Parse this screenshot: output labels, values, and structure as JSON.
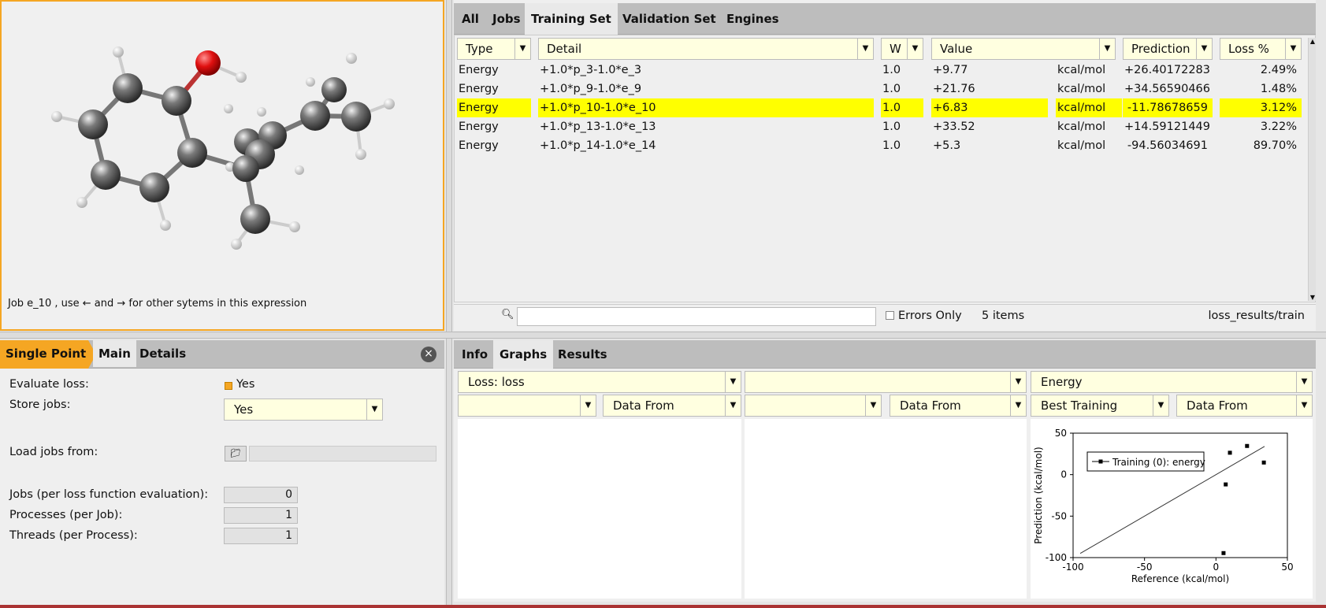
{
  "molecule_panel": {
    "caption": "Job e_10 , use ← and → for other sytems in this expression"
  },
  "top_tabs": [
    "All",
    "Jobs",
    "Training Set",
    "Validation Set",
    "Engines"
  ],
  "table": {
    "headers": {
      "type": "Type",
      "detail": "Detail",
      "w": "W",
      "value": "Value",
      "prediction": "Prediction",
      "loss": "Loss %"
    },
    "rows": [
      {
        "type": "Energy",
        "detail": "+1.0*p_3-1.0*e_3",
        "w": "1.0",
        "value": "+9.77",
        "unit": "kcal/mol",
        "prediction": "+26.40172283",
        "loss": "2.49%"
      },
      {
        "type": "Energy",
        "detail": "+1.0*p_9-1.0*e_9",
        "w": "1.0",
        "value": "+21.76",
        "unit": "kcal/mol",
        "prediction": "+34.56590466",
        "loss": "1.48%"
      },
      {
        "type": "Energy",
        "detail": "+1.0*p_10-1.0*e_10",
        "w": "1.0",
        "value": "+6.83",
        "unit": "kcal/mol",
        "prediction": "-11.78678659",
        "loss": "3.12%"
      },
      {
        "type": "Energy",
        "detail": "+1.0*p_13-1.0*e_13",
        "w": "1.0",
        "value": "+33.52",
        "unit": "kcal/mol",
        "prediction": "+14.59121449",
        "loss": "3.22%"
      },
      {
        "type": "Energy",
        "detail": "+1.0*p_14-1.0*e_14",
        "w": "1.0",
        "value": "+5.3",
        "unit": "kcal/mol",
        "prediction": "-94.56034691",
        "loss": "89.70%"
      }
    ],
    "highlight_color": "#ffff00"
  },
  "status": {
    "search_value": "",
    "errors_only_label": "Errors Only",
    "item_count": "5 items",
    "path": "loss_results/train"
  },
  "settings": {
    "tabs": [
      "Single Point",
      "Main",
      "Details"
    ],
    "evaluate_loss_label": "Evaluate loss:",
    "evaluate_loss_value": "Yes",
    "store_jobs_label": "Store jobs:",
    "store_jobs_value": "Yes",
    "load_jobs_label": "Load jobs from:",
    "jobs_label": "Jobs (per loss function evaluation):",
    "jobs_value": "0",
    "processes_label": "Processes (per Job):",
    "processes_value": "1",
    "threads_label": "Threads (per Process):",
    "threads_value": "1"
  },
  "bottom_tabs": [
    "Info",
    "Graphs",
    "Results"
  ],
  "graphs": {
    "pane1": {
      "top": "Loss: loss",
      "left": "",
      "right": "Data From"
    },
    "pane2": {
      "top": "",
      "left": "",
      "right": "Data From"
    },
    "pane3": {
      "top": "Energy",
      "left": "Best Training",
      "right": "Data From"
    }
  },
  "chart_data": {
    "type": "scatter",
    "xlabel": "Reference (kcal/mol)",
    "ylabel": "Prediction (kcal/mol)",
    "xlim": [
      -100,
      50
    ],
    "ylim": [
      -100,
      50
    ],
    "xticks": [
      "-100",
      "-50",
      "0",
      "50"
    ],
    "yticks": [
      "50",
      "0",
      "-50",
      "-100"
    ],
    "legend": "Training (0): energy",
    "legend_position": "top-left",
    "series": [
      {
        "name": "Training (0): energy",
        "x": [
          9.77,
          21.76,
          6.83,
          33.52,
          5.3
        ],
        "y": [
          26.4,
          34.57,
          -11.79,
          14.59,
          -94.56
        ]
      }
    ],
    "reference_line": {
      "x": [
        -95,
        34
      ],
      "y": [
        -95,
        34
      ]
    }
  },
  "colors": {
    "accent": "#f5a623",
    "highlight": "#ffff00",
    "field": "#ffffe0"
  }
}
